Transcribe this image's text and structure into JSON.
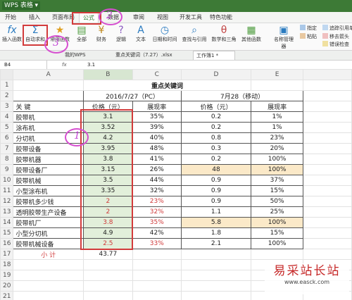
{
  "app": {
    "logo": "WPS 表格",
    "dropdown": "▾"
  },
  "menu": [
    "开始",
    "插入",
    "页面布局",
    "公式",
    "数据",
    "审阅",
    "视图",
    "开发工具",
    "特色功能"
  ],
  "ribbon": {
    "insert_fn": "插入函数",
    "autosum": "自动求和",
    "recent": "常用函数",
    "all": "全部",
    "finance": "财务",
    "logic": "逻辑",
    "text": "文本",
    "datetime": "日期和时间",
    "lookup": "查找与引用",
    "math": "数学和三角",
    "other": "其他函数",
    "name_mgr": "名称管理器",
    "specify": "指定",
    "paste": "粘贴",
    "trace": "追踪引用单元格",
    "formula": "公式求值",
    "removearrow": "移去箭头",
    "errcheck": "错误检查"
  },
  "doc_tabs": [
    "我的WPS",
    "重点关键词（7.27）.xlsx",
    "工作簿1 *"
  ],
  "formula_bar": {
    "cell": "B4",
    "fx": "fx",
    "value": "3.1"
  },
  "col_headers": [
    "A",
    "B",
    "C",
    "D",
    "E"
  ],
  "row_headers": [
    "1",
    "2",
    "3",
    "4",
    "5",
    "6",
    "7",
    "8",
    "9",
    "10",
    "11",
    "12",
    "13",
    "14",
    "15",
    "16",
    "17",
    "18",
    "19",
    "20",
    "21"
  ],
  "sheet": {
    "title": "重点关键词",
    "date1": "2016/7/27（PC）",
    "date2": "7月28（移动）",
    "kw_label": "关 键",
    "h_price1": "价格（元）",
    "h_rate1": "展现率",
    "h_price2": "价格（元）",
    "h_rate2": "展现率",
    "rows": [
      {
        "kw": "胶带机",
        "p1": "3.1",
        "r1": "35%",
        "p2": "0.2",
        "r2": "1%"
      },
      {
        "kw": "涂布机",
        "p1": "3.52",
        "r1": "39%",
        "p2": "0.2",
        "r2": "1%"
      },
      {
        "kw": "分切机",
        "p1": "4.2",
        "r1": "40%",
        "p2": "0.8",
        "r2": "23%"
      },
      {
        "kw": "胶带设备",
        "p1": "3.95",
        "r1": "48%",
        "p2": "0.3",
        "r2": "20%"
      },
      {
        "kw": "胶带机器",
        "p1": "3.8",
        "r1": "41%",
        "p2": "0.2",
        "r2": "100%"
      },
      {
        "kw": "胶带设备厂",
        "p1": "3.15",
        "r1": "26%",
        "p2": "48",
        "r2": "100%"
      },
      {
        "kw": "胶带机械",
        "p1": "3.5",
        "r1": "44%",
        "p2": "0.9",
        "r2": "37%"
      },
      {
        "kw": "小型涂布机",
        "p1": "3.35",
        "r1": "32%",
        "p2": "0.9",
        "r2": "15%"
      },
      {
        "kw": "胶带机多少钱",
        "p1": "2",
        "r1": "23%",
        "p2": "0.9",
        "r2": "50%"
      },
      {
        "kw": "透明胶带生产设备",
        "p1": "2",
        "r1": "32%",
        "p2": "1.1",
        "r2": "25%"
      },
      {
        "kw": "胶带机厂",
        "p1": "3.8",
        "r1": "35%",
        "p2": "5.8",
        "r2": "100%"
      },
      {
        "kw": "小型分切机",
        "p1": "4.9",
        "r1": "42%",
        "p2": "1.8",
        "r2": "15%"
      },
      {
        "kw": "胶带机械设备",
        "p1": "2.5",
        "r1": "33%",
        "p2": "2.1",
        "r2": "100%"
      }
    ],
    "subtotal_label": "小 计",
    "subtotal_value": "43.77"
  },
  "annotations": {
    "one": "1",
    "two": "2",
    "three": "3"
  },
  "watermark": {
    "title": "易采站长站",
    "url": "www.easck.com"
  },
  "colors": {
    "accent": "#3d7a36",
    "redbox": "#d23b3b",
    "annot": "#d64fd0",
    "green_fill": "#e2efda",
    "tan_fill": "#fbe9c8"
  }
}
